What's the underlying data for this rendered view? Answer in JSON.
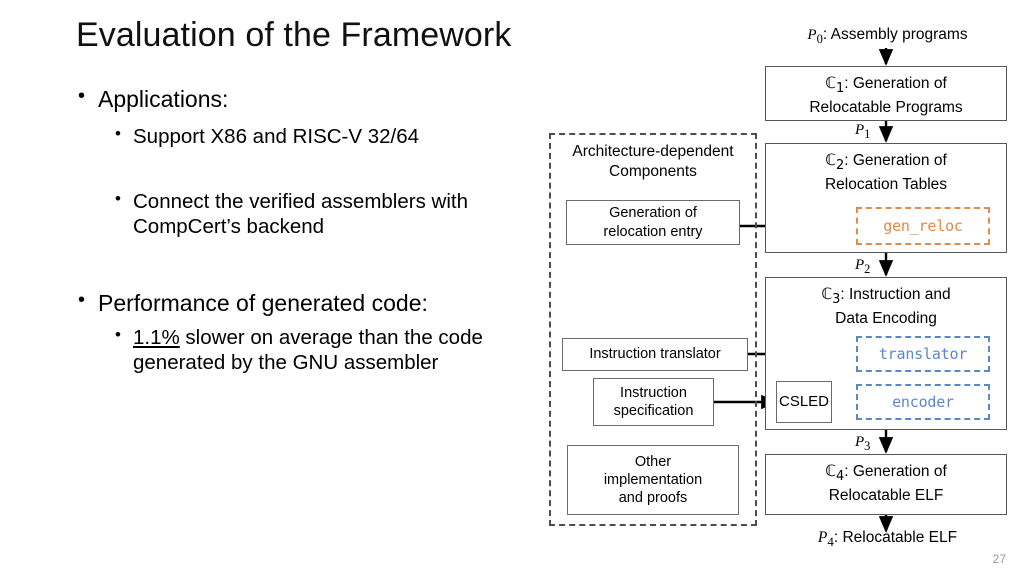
{
  "slide": {
    "title": "Evaluation of the Framework",
    "page_number": "27"
  },
  "bullets": [
    {
      "level": 1,
      "marker": "•",
      "text": "Applications:"
    },
    {
      "level": 2,
      "marker": "•",
      "text": "Support X86 and RISC-V 32/64"
    },
    {
      "level": 2,
      "marker": "•",
      "text": "Connect the verified assemblers with CompCert’s backend"
    },
    {
      "level": 1,
      "marker": "•",
      "text": "Performance of generated code:"
    },
    {
      "level": 2,
      "marker": "•",
      "underlined_prefix": "1.1%",
      "text": " slower on average than the code generated by the GNU assembler"
    }
  ],
  "diagram": {
    "top_caption": "Assembly programs",
    "top_caption_var": "P",
    "top_caption_sub": "0",
    "bottom_caption": "Relocatable ELF",
    "bottom_caption_var": "P",
    "bottom_caption_sub": "4",
    "arch_panel": {
      "title_line1": "Architecture-dependent",
      "title_line2": "Components",
      "boxes": [
        {
          "id": "gen-reloc-entry",
          "line1": "Generation of",
          "line2": "relocation entry"
        },
        {
          "id": "instruction-translator",
          "line1": "Instruction translator",
          "line2": ""
        },
        {
          "id": "instruction-specification",
          "line1": "Instruction",
          "line2": "specification"
        },
        {
          "id": "other-impl-proofs",
          "line1": "Other",
          "line2": "implementation",
          "line3": "and proofs"
        }
      ]
    },
    "stages": [
      {
        "id": "c1",
        "symbol": "ℂ",
        "sub": "1",
        "line1": ": Generation of",
        "line2": "Relocatable Programs",
        "out_label_var": "P",
        "out_label_sub": "1"
      },
      {
        "id": "c2",
        "symbol": "ℂ",
        "sub": "2",
        "line1": ": Generation of",
        "line2": "Relocation Tables",
        "out_label_var": "P",
        "out_label_sub": "2"
      },
      {
        "id": "c3",
        "symbol": "ℂ",
        "sub": "3",
        "line1": ": Instruction and",
        "line2": "Data Encoding",
        "out_label_var": "P",
        "out_label_sub": "3"
      },
      {
        "id": "c4",
        "symbol": "ℂ",
        "sub": "4",
        "line1": ": Generation of",
        "line2": "Relocatable ELF",
        "out_label_var": "",
        "out_label_sub": ""
      }
    ],
    "code_nodes": [
      {
        "id": "gen_reloc",
        "label": "gen_reloc",
        "color": "#e08a4b"
      },
      {
        "id": "translator",
        "label": "translator",
        "color": "#5b87c9"
      },
      {
        "id": "encoder",
        "label": "encoder",
        "color": "#5b87c9"
      }
    ],
    "csled_box": {
      "label": "CSLED"
    },
    "colors": {
      "orange": "#e08a4b",
      "blue": "#5b87c9",
      "box_border": "#575757",
      "panel_border": "#4d4d4d"
    }
  }
}
